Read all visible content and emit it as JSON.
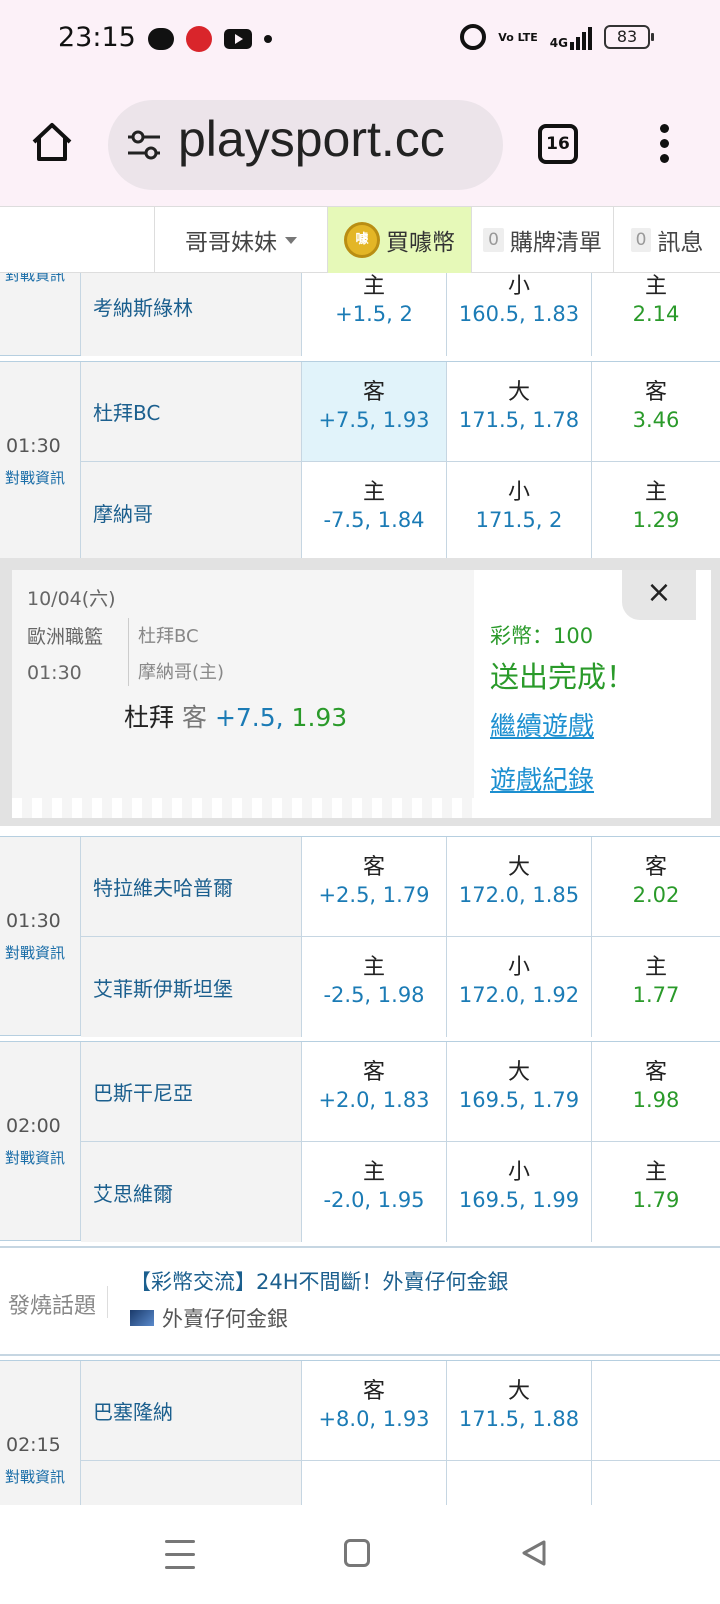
{
  "status_bar": {
    "time": "23:15",
    "battery": "83",
    "icons": [
      "chat-icon",
      "app-logo-icon",
      "youtube-icon",
      "dot-icon",
      "alarm-icon",
      "volte-icon",
      "signal-4g-icon",
      "battery-icon"
    ],
    "volte": "Vo LTE",
    "network": "4G"
  },
  "browser": {
    "url": "playsport.cc",
    "tab_count": "16"
  },
  "site_nav": {
    "user": "哥哥妹妹",
    "buy_coins": "買噱幣",
    "coin_glyph": "噱",
    "cart_count": "0",
    "cart": "購牌清單",
    "msg_count": "0",
    "messages": "訊息"
  },
  "matches": [
    {
      "time": "",
      "info": "對戰資訊",
      "rows": [
        {
          "team": "考納斯綠林",
          "spread_side": "主",
          "spread": "+1.5, 2",
          "total_side": "小",
          "total": "160.5, 1.83",
          "ml_side": "主",
          "ml": "2.14"
        }
      ]
    },
    {
      "time": "01:30",
      "info": "對戰資訊",
      "rows": [
        {
          "team": "杜拜BC",
          "spread_side": "客",
          "spread": "+7.5, 1.93",
          "total_side": "大",
          "total": "171.5, 1.78",
          "ml_side": "客",
          "ml": "3.46"
        },
        {
          "team": "摩納哥",
          "spread_side": "主",
          "spread": "-7.5, 1.84",
          "total_side": "小",
          "total": "171.5, 2",
          "ml_side": "主",
          "ml": "1.29"
        }
      ]
    },
    {
      "time": "01:30",
      "info": "對戰資訊",
      "rows": [
        {
          "team": "特拉維夫哈普爾",
          "spread_side": "客",
          "spread": "+2.5, 1.79",
          "total_side": "大",
          "total": "172.0, 1.85",
          "ml_side": "客",
          "ml": "2.02"
        },
        {
          "team": "艾菲斯伊斯坦堡",
          "spread_side": "主",
          "spread": "-2.5, 1.98",
          "total_side": "小",
          "total": "172.0, 1.92",
          "ml_side": "主",
          "ml": "1.77"
        }
      ]
    },
    {
      "time": "02:00",
      "info": "對戰資訊",
      "rows": [
        {
          "team": "巴斯干尼亞",
          "spread_side": "客",
          "spread": "+2.0, 1.83",
          "total_side": "大",
          "total": "169.5, 1.79",
          "ml_side": "客",
          "ml": "1.98"
        },
        {
          "team": "艾思維爾",
          "spread_side": "主",
          "spread": "-2.0, 1.95",
          "total_side": "小",
          "total": "169.5, 1.99",
          "ml_side": "主",
          "ml": "1.79"
        }
      ]
    },
    {
      "time": "02:15",
      "info": "對戰資訊",
      "rows": [
        {
          "team": "巴塞隆納",
          "spread_side": "客",
          "spread": "+8.0, 1.93",
          "total_side": "大",
          "total": "171.5, 1.88",
          "ml_side": "",
          "ml": ""
        }
      ]
    }
  ],
  "popup": {
    "date": "10/04(六)",
    "league": "歐洲職籃",
    "time": "01:30",
    "team1": "杜拜BC",
    "team2": "摩納哥(主)",
    "bet_team": "杜拜",
    "bet_side": "客",
    "bet_line": "+7.5,",
    "bet_price": "1.93",
    "coins": "彩幣：100",
    "status": "送出完成！",
    "continue": "繼續遊戲",
    "history": "遊戲紀錄",
    "close": "×"
  },
  "hot_topic": {
    "label": "發燒話題",
    "title": "【彩幣交流】24H不間斷！外賣仔何金銀",
    "author": "外賣仔何金銀"
  }
}
